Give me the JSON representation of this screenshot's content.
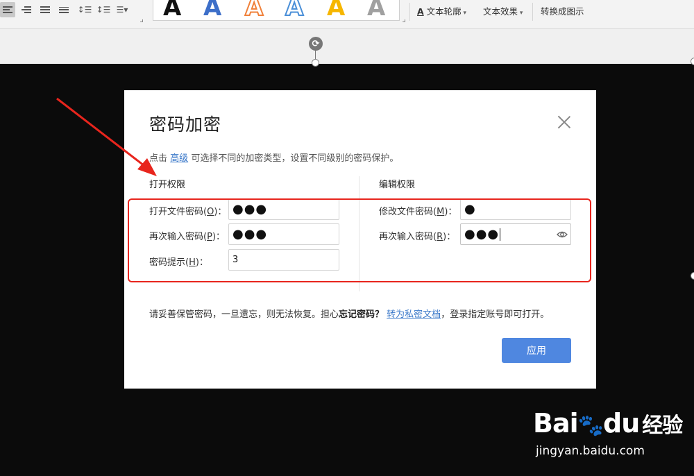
{
  "toolbar": {
    "art_letter": "A",
    "art_styles": [
      {
        "name": "black",
        "fill": "#111111",
        "stroke": "none"
      },
      {
        "name": "blue",
        "fill": "#3d6fc9",
        "stroke": "none"
      },
      {
        "name": "orange-outline",
        "fill": "#ffffff",
        "stroke": "#f0813a"
      },
      {
        "name": "blue-outline",
        "fill": "#ffffff",
        "stroke": "#4a8fd8"
      },
      {
        "name": "yellow",
        "fill": "#f6b600",
        "stroke": "none"
      },
      {
        "name": "gray",
        "fill": "#a0a0a0",
        "stroke": "none"
      }
    ],
    "text_outline_label": "文本轮廓",
    "text_effect_label": "文本效果",
    "convert_label": "转换成图示"
  },
  "dialog": {
    "title": "密码加密",
    "desc_prefix": "点击",
    "desc_link": "高级",
    "desc_suffix": "可选择不同的加密类型，设置不同级别的密码保护。",
    "open_section": {
      "title": "打开权限",
      "password_label": "打开文件密码",
      "password_key": "O",
      "password_value": "●●●",
      "confirm_label": "再次输入密码",
      "confirm_key": "P",
      "confirm_value": "●●●",
      "hint_label": "密码提示",
      "hint_key": "H",
      "hint_value": "3"
    },
    "edit_section": {
      "title": "编辑权限",
      "password_label": "修改文件密码",
      "password_key": "M",
      "password_value": "●",
      "confirm_label": "再次输入密码",
      "confirm_key": "R",
      "confirm_value": "●●●"
    },
    "footer_prefix": "请妥善保管密码，一旦遗忘，则无法恢复。担心",
    "footer_bold": "忘记密码？",
    "footer_link": "转为私密文档",
    "footer_suffix": "，登录指定账号即可打开。",
    "apply_label": "应用"
  },
  "watermark": {
    "brand": "Bai",
    "brand2": "du",
    "brand_cn": "经验",
    "url": "jingyan.baidu.com"
  },
  "colors": {
    "accent": "#4f87e0",
    "annotation_red": "#e8251d",
    "link": "#3a78c9"
  }
}
